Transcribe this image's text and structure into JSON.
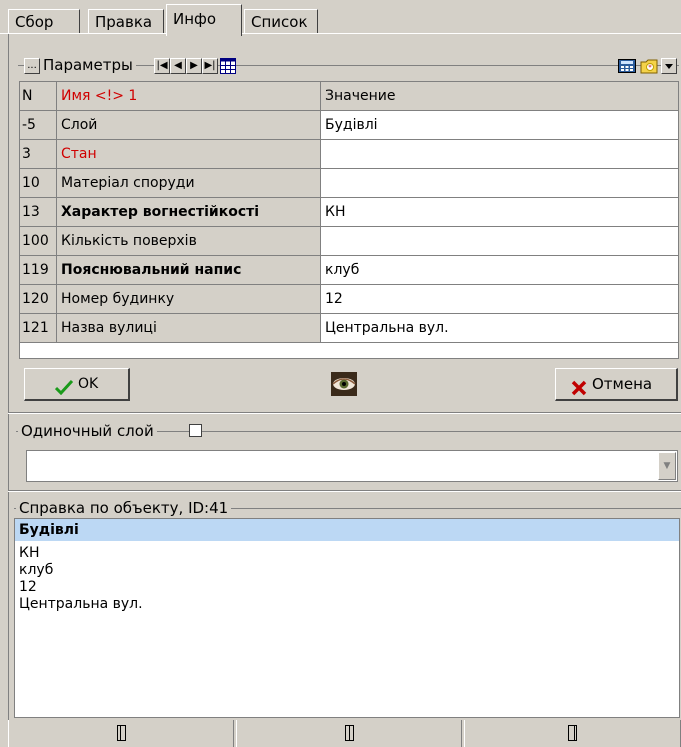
{
  "tabs": [
    {
      "label": "Сбор"
    },
    {
      "label": "Правка"
    },
    {
      "label": "Инфо"
    },
    {
      "label": "Список"
    }
  ],
  "params_group": {
    "label": "Параметры",
    "nav": [
      "|◀",
      "◀",
      "▶",
      "▶|"
    ],
    "ellipsis": "..."
  },
  "table": {
    "header": {
      "n": "N",
      "name": "Имя <!> 1",
      "value": "Значение"
    },
    "rows": [
      {
        "n": "-5",
        "name": "Слой",
        "value": "Будівлі"
      },
      {
        "n": "3",
        "name": "Стан",
        "value": ""
      },
      {
        "n": "10",
        "name": "Матеріал споруди",
        "value": ""
      },
      {
        "n": "13",
        "name": "Характер вогнестійкості",
        "value": "КН"
      },
      {
        "n": "100",
        "name": "Кількість поверхів",
        "value": ""
      },
      {
        "n": "119",
        "name": "Пояснювальний напис",
        "value": "клуб"
      },
      {
        "n": "120",
        "name": "Номер будинку",
        "value": "12"
      },
      {
        "n": "121",
        "name": "Назва вулиці",
        "value": "Центральна вул."
      }
    ]
  },
  "buttons": {
    "ok": "OK",
    "cancel": "Отмена"
  },
  "single_layer": {
    "label": "Одиночный слой",
    "checked": false,
    "value": ""
  },
  "object_info": {
    "label": "Справка по объекту, ID:41",
    "title": "Будівлі",
    "lines": [
      "КН",
      "клуб",
      "12",
      "Центральна вул."
    ]
  },
  "colors": {
    "face": "#d4d0c8",
    "highlight_red": "#d00000",
    "selection": "#bcd8f4",
    "ok_check": "#1a9a1a",
    "cancel_x": "#c00000"
  }
}
